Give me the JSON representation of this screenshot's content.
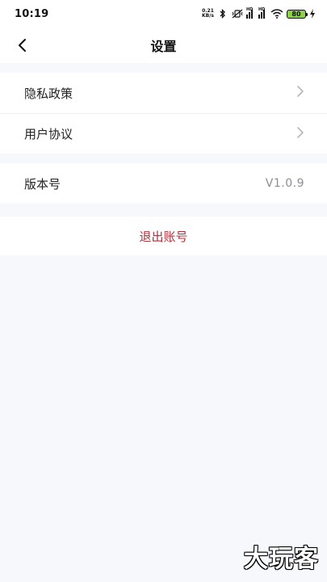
{
  "status_bar": {
    "time": "10:19",
    "net_speed_value": "0.21",
    "net_speed_unit": "KB/s",
    "signal1_tag": "HD",
    "signal2_tag": "HD",
    "battery_level": "80",
    "battery_color": "#8bd14a"
  },
  "nav": {
    "title": "设置"
  },
  "settings": {
    "privacy_policy": "隐私政策",
    "user_agreement": "用户协议",
    "version_label": "版本号",
    "version_value": "V1.0.9"
  },
  "logout": {
    "label": "退出账号",
    "color": "#b0303a"
  },
  "watermark": {
    "text": "大玩客"
  }
}
